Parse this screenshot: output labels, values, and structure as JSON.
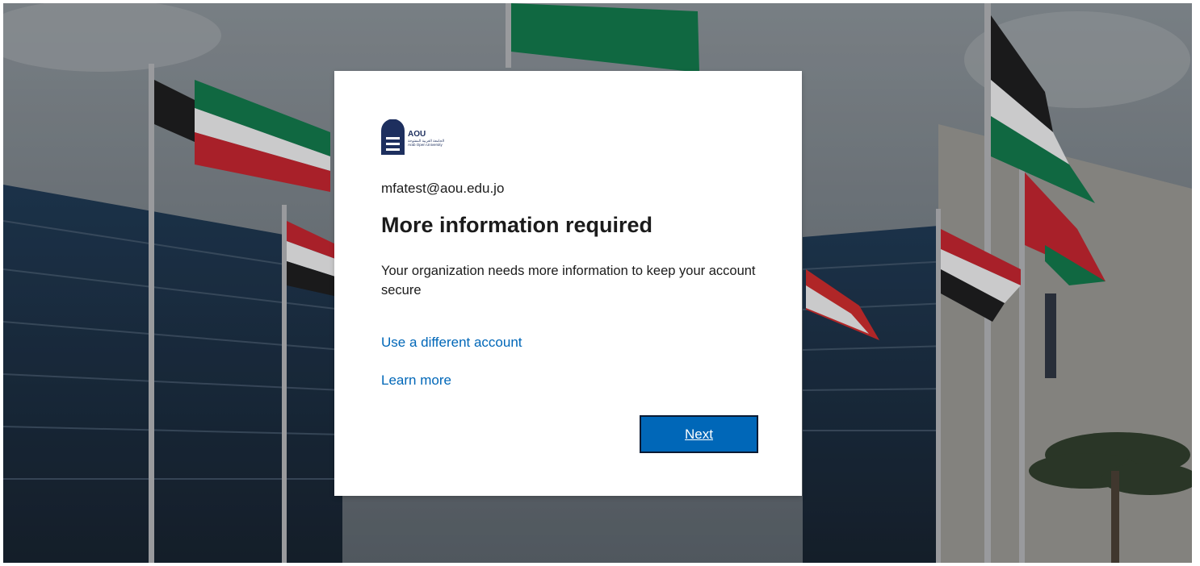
{
  "brand": {
    "logo_name": "AOU",
    "logo_subtitle_ar": "الجامعة العربية المفتوحة",
    "logo_subtitle_en": "Arab Open University",
    "primary_color": "#0067b8",
    "logo_color": "#1d2f5e"
  },
  "signin": {
    "identity": "mfatest@aou.edu.jo",
    "title": "More information required",
    "description": "Your organization needs more information to keep your account secure",
    "links": {
      "other_account": "Use a different account",
      "learn_more": "Learn more"
    },
    "next_button": "Next"
  },
  "background": {
    "description_icon": "campus-flags-background"
  }
}
